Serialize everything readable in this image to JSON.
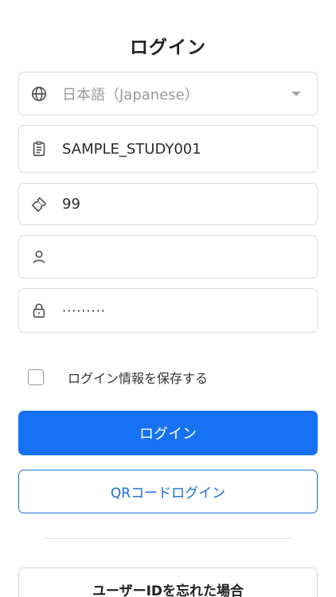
{
  "header": {
    "title": "ログイン"
  },
  "form": {
    "language": {
      "selected": "日本語（Japanese）",
      "icon": "globe-icon"
    },
    "study_id": {
      "value": "SAMPLE_STUDY001",
      "icon": "clipboard-icon"
    },
    "ticket": {
      "value": "99",
      "icon": "ticket-icon"
    },
    "user": {
      "value": "",
      "icon": "user-icon"
    },
    "password": {
      "value": "·········",
      "icon": "lock-icon"
    },
    "remember": {
      "label": "ログイン情報を保存する",
      "checked": false
    }
  },
  "actions": {
    "login_label": "ログイン",
    "qr_login_label": "QRコードログイン",
    "forgot_id_label": "ユーザーIDを忘れた場合"
  },
  "colors": {
    "primary": "#1672f3",
    "outline": "#1a6fd6",
    "border": "#dcdcdc"
  }
}
